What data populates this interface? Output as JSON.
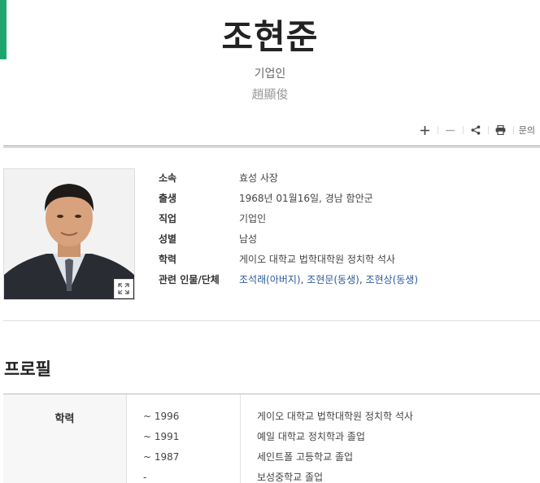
{
  "header": {
    "name": "조현준",
    "occupation": "기업인",
    "hanja": "趙顯俊"
  },
  "toolbar": {
    "items": [
      {
        "name": "plus-icon"
      },
      {
        "name": "minus-icon"
      },
      {
        "name": "share-icon"
      },
      {
        "name": "print-icon"
      }
    ],
    "inquiry_label": "문의"
  },
  "info": {
    "rows": [
      {
        "label": "소속",
        "value": "효성 사장"
      },
      {
        "label": "출생",
        "value": "1968년 01월16일, 경남 함안군"
      },
      {
        "label": "직업",
        "value": "기업인"
      },
      {
        "label": "성별",
        "value": "남성"
      },
      {
        "label": "학력",
        "value": "게이오 대학교 법학대학원 정치학 석사"
      }
    ],
    "related_label": "관련 인물/단체",
    "related": [
      {
        "text": "조석래(아버지)",
        "sep": ", "
      },
      {
        "text": "조현문(동생)",
        "sep": ", "
      },
      {
        "text": "조현상(동생)",
        "sep": ""
      }
    ]
  },
  "profile": {
    "section_title": "프로필",
    "education_label": "학력",
    "education": [
      {
        "year": "~ 1996",
        "desc": "게이오 대학교 법학대학원 정치학 석사"
      },
      {
        "year": "~ 1991",
        "desc": "예일 대학교 정치학과 졸업"
      },
      {
        "year": "~ 1987",
        "desc": "세인트폴 고등학교 졸업"
      },
      {
        "year": "-",
        "desc": "보성중학교 졸업"
      }
    ]
  },
  "colors": {
    "accent": "#1fa670",
    "link": "#2c5a9a"
  }
}
